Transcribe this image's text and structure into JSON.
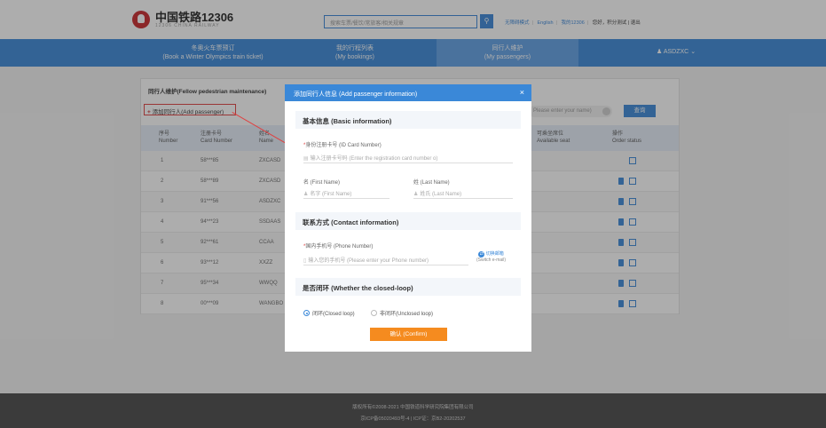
{
  "header": {
    "logo_cn": "中国铁路12306",
    "logo_en": "12306 CHINA RAILWAY",
    "search_placeholder": "搜索车票/餐饮/常旅客/相关规章",
    "search_icon": "search-icon",
    "links": [
      "无障碍模式",
      "English",
      "我的12306",
      "您好，积分测试 | 退出"
    ]
  },
  "nav": {
    "items": [
      {
        "label_cn": "冬奥火车票预订",
        "label_en": "(Book a Winter Olympics train ticket)"
      },
      {
        "label_cn": "我的行程列表",
        "label_en": "(My bookings)"
      },
      {
        "label_cn": "同行人维护",
        "label_en": "(My passengers)"
      }
    ],
    "user": "ASDZXC",
    "user_icon": "user-icon"
  },
  "page": {
    "title": "同行人维护(Fellow pedestrian maintenance)",
    "add_button": "添加同行人(Add passenger)",
    "search_placeholder": "Please enter your name)",
    "search_button": "查询"
  },
  "table": {
    "headers": [
      {
        "cn": "序号",
        "en": "Number"
      },
      {
        "cn": "注册卡号",
        "en": "Card Number"
      },
      {
        "cn": "姓名",
        "en": "Name"
      },
      {
        "cn": "可乘坐席位",
        "en": "Available seat"
      },
      {
        "cn": "操作",
        "en": "Order status"
      }
    ],
    "rows": [
      {
        "no": "1",
        "card": "58***85",
        "name": "ZXCASD"
      },
      {
        "no": "2",
        "card": "58***89",
        "name": "ZXCASD"
      },
      {
        "no": "3",
        "card": "91***56",
        "name": "ASDZXC"
      },
      {
        "no": "4",
        "card": "94***23",
        "name": "SSDAAS"
      },
      {
        "no": "5",
        "card": "92***61",
        "name": "CCAA"
      },
      {
        "no": "6",
        "card": "93***12",
        "name": "XXZZ"
      },
      {
        "no": "7",
        "card": "95***34",
        "name": "WWQQ"
      },
      {
        "no": "8",
        "card": "00***09",
        "name": "WANGBO"
      }
    ]
  },
  "modal": {
    "title": "添加同行人信息 (Add passenger information)",
    "close": "×",
    "basic_title": "基本信息 (Basic information)",
    "card_label": "身份注册卡号 (ID Card Number)",
    "card_placeholder": "输入注册卡号码 (Enter the registration card number o)",
    "first_label": "名 (First Name)",
    "first_placeholder": "名字 (First Name)",
    "last_label": "姓 (Last Name)",
    "last_placeholder": "姓氏 (Last Name)",
    "contact_title": "联系方式 (Contact information)",
    "phone_label": "国内手机号 (Phone Number)",
    "phone_placeholder": "输入您的手机号 (Please enter your Phone number)",
    "switch_cn": "切换邮箱",
    "switch_en": "(Switch e-mail)",
    "loop_title": "是否闭环 (Whether the closed-loop)",
    "closed_loop": "闭环(Closed loop)",
    "unclosed_loop": "非闭环(Unclosed loop)",
    "confirm": "确认 (Confirm)"
  },
  "footer": {
    "line1": "版权所有©2008-2021   中国铁道科学研究院集团有限公司",
    "line2": "京ICP备05020493号-4  |  ICP证：京B2-20202537"
  }
}
